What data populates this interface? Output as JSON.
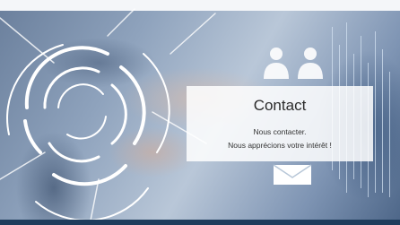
{
  "contact": {
    "title": "Contact",
    "line1": "Nous contacter.",
    "line2": "Nous apprécions votre intérêt !"
  },
  "icons": {
    "people": "people-group-icon",
    "mail": "envelope-icon"
  },
  "colors": {
    "card_bg": "#ffffff",
    "text": "#2b2b2b",
    "bottom_bar": "#1f3d5c"
  }
}
